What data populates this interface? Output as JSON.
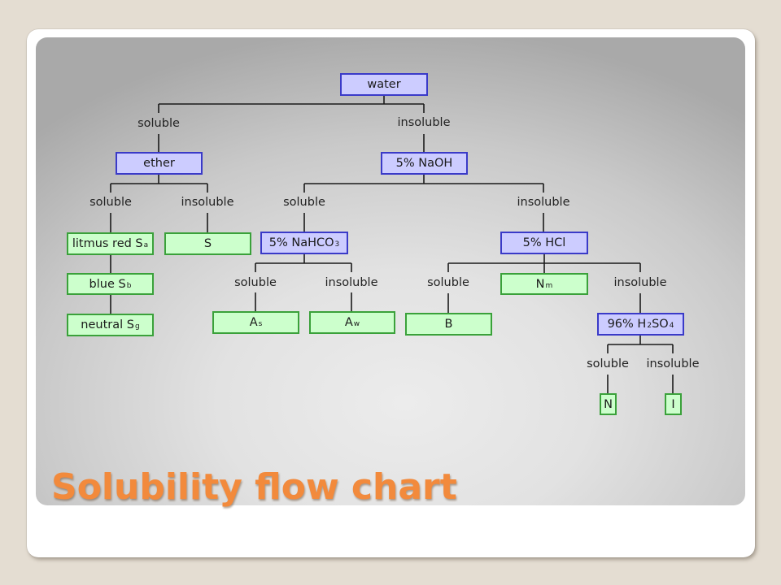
{
  "slide": {
    "title": "Solubility flow chart"
  },
  "colors": {
    "background": "#e4ddd2",
    "test_fill": "#ccccff",
    "test_border": "#3a3ac8",
    "class_fill": "#ccffcc",
    "class_border": "#3aa13a",
    "title": "#f28a3c"
  },
  "nodes": {
    "water": {
      "text": "water",
      "kind": "test"
    },
    "ether": {
      "text": "ether",
      "kind": "test"
    },
    "naoh": {
      "text": "5% NaOH",
      "kind": "test"
    },
    "litmus_red": {
      "text": "litmus red S",
      "sub": "a",
      "kind": "class"
    },
    "s": {
      "text": "S",
      "kind": "class"
    },
    "nahco3": {
      "text": "5% NaHCO",
      "sub": "3",
      "kind": "test"
    },
    "hcl": {
      "text": "5% HCl",
      "kind": "test"
    },
    "blue": {
      "text": "blue S",
      "sub": "b",
      "kind": "class"
    },
    "nm": {
      "text": "N",
      "sub": "m",
      "kind": "class"
    },
    "neutral": {
      "text": "neutral S",
      "sub": "g",
      "kind": "class"
    },
    "as": {
      "text": "A",
      "sub": "s",
      "kind": "class"
    },
    "aw": {
      "text": "A",
      "sub": "w",
      "kind": "class"
    },
    "b": {
      "text": "B",
      "kind": "class"
    },
    "h2so4": {
      "text": "96% H",
      "sub": "2",
      "text2": "SO",
      "sub2": "4",
      "kind": "test"
    },
    "n": {
      "text": "N",
      "kind": "class"
    },
    "i": {
      "text": "I",
      "kind": "class"
    }
  },
  "labels": {
    "water_soluble": "soluble",
    "water_insoluble": "insoluble",
    "ether_soluble": "soluble",
    "ether_insoluble": "insoluble",
    "naoh_soluble": "soluble",
    "naoh_insoluble": "insoluble",
    "nahco3_soluble": "soluble",
    "nahco3_insoluble": "insoluble",
    "hcl_soluble": "soluble",
    "hcl_insoluble": "insoluble",
    "h2so4_soluble": "soluble",
    "h2so4_insoluble": "insoluble"
  },
  "edges": [
    {
      "from": "water",
      "to": "ether",
      "label": "soluble"
    },
    {
      "from": "water",
      "to": "naoh",
      "label": "insoluble"
    },
    {
      "from": "ether",
      "to": "litmus_red",
      "label": "soluble"
    },
    {
      "from": "ether",
      "to": "s",
      "label": "insoluble"
    },
    {
      "from": "litmus_red",
      "to": "blue",
      "label": ""
    },
    {
      "from": "blue",
      "to": "neutral",
      "label": ""
    },
    {
      "from": "naoh",
      "to": "nahco3",
      "label": "soluble"
    },
    {
      "from": "naoh",
      "to": "hcl",
      "label": "insoluble"
    },
    {
      "from": "nahco3",
      "to": "as",
      "label": "soluble"
    },
    {
      "from": "nahco3",
      "to": "aw",
      "label": "insoluble"
    },
    {
      "from": "hcl",
      "to": "b",
      "label": "soluble"
    },
    {
      "from": "hcl",
      "to": "nm",
      "label": ""
    },
    {
      "from": "hcl",
      "to": "h2so4",
      "label": "insoluble"
    },
    {
      "from": "h2so4",
      "to": "n",
      "label": "soluble"
    },
    {
      "from": "h2so4",
      "to": "i",
      "label": "insoluble"
    }
  ]
}
